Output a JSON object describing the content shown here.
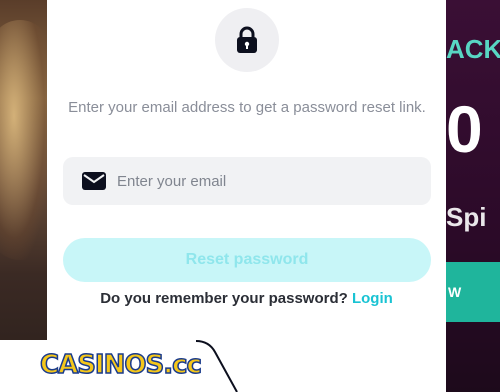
{
  "background": {
    "promo_line1": "ACK",
    "promo_line2": "0",
    "promo_line3": "Spi",
    "promo_button": "W"
  },
  "modal": {
    "icon": "lock-icon",
    "description": "Enter your email address to get a password reset link.",
    "email_field": {
      "icon": "mail-icon",
      "placeholder": "Enter your email",
      "value": ""
    },
    "reset_button_label": "Reset password",
    "remember_text": "Do you remember your password?",
    "login_link_label": "Login"
  },
  "watermark": {
    "logo_text": "CASINOS.cc"
  },
  "colors": {
    "accent": "#19c3d3",
    "button_bg": "#c8f6f8",
    "button_text": "#8fe6ec",
    "logo_yellow": "#f5c71a",
    "logo_blue": "#1a3b8c"
  }
}
